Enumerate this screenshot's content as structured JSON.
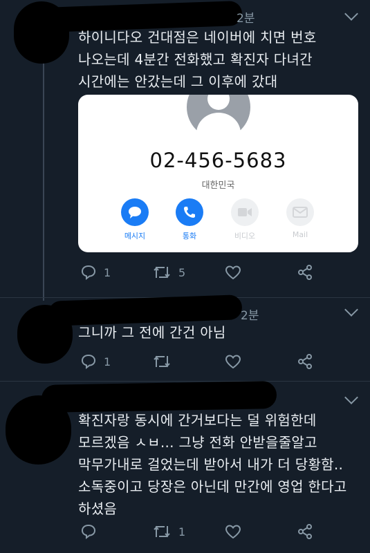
{
  "tweets": [
    {
      "time": "2분",
      "text": "하이니다오 건대점은 네이버에 치면 번호\n나오는데 4분간 전화했고 확진자 다녀간\n시간에는 안갔는데 그 이후에 갔대",
      "reply_count": "1",
      "retweet_count": "5",
      "like_count": ""
    },
    {
      "time": "2분",
      "text": "그니까 그 전에 간건 아님",
      "reply_count": "1",
      "retweet_count": "",
      "like_count": ""
    },
    {
      "time": "",
      "text": "확진자랑 동시에 간거보다는 덜 위험한데\n모르겠음 ㅅㅂ... 그냥 전화 안받을줄알고\n막무가내로 걸었는데 받아서 내가 더 당황함..\n소독중이고 당장은 아닌데 만간에 영업 한다고\n하셨음",
      "reply_count": "",
      "retweet_count": "1",
      "like_count": ""
    }
  ],
  "contact_card": {
    "phone": "02-456-5683",
    "country": "대한민국",
    "actions": [
      {
        "label": "메시지",
        "icon": "message-icon",
        "color": "#1a7cf5",
        "enabled": true
      },
      {
        "label": "통화",
        "icon": "phone-icon",
        "color": "#1a7cf5",
        "enabled": true
      },
      {
        "label": "비디오",
        "icon": "video-icon",
        "color": "#d4d6d9",
        "enabled": false
      },
      {
        "label": "Mail",
        "icon": "mail-icon",
        "color": "#d4d6d9",
        "enabled": false
      }
    ]
  },
  "colors": {
    "background": "#151e29",
    "text": "#e9edf1",
    "muted": "#8899a6",
    "accent": "#1a7cf5"
  }
}
